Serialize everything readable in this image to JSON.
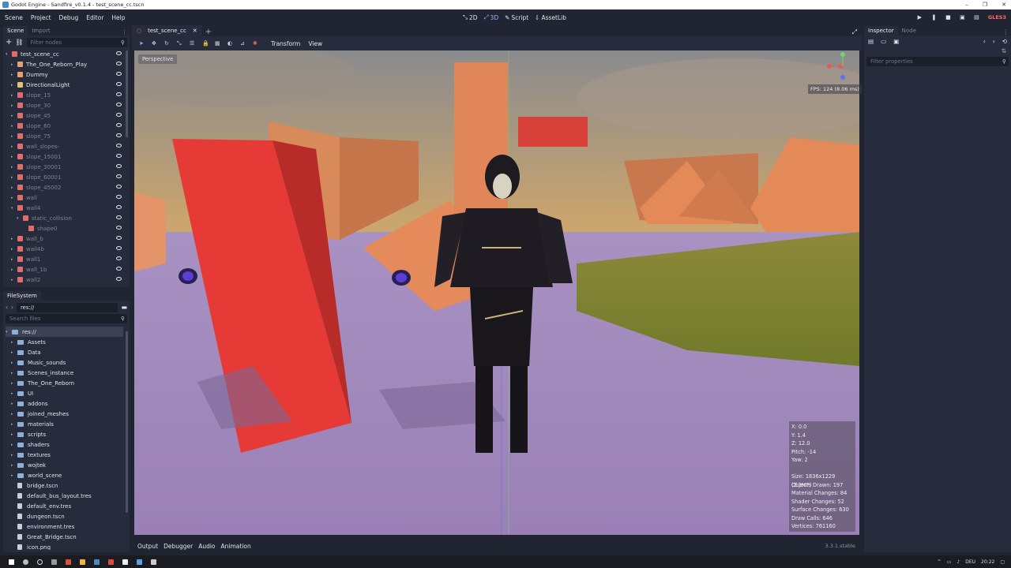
{
  "window": {
    "title": "Godot Engine - Sandfire_v0.1.4 - test_scene_cc.tscn",
    "controls": [
      "–",
      "❐",
      "✕"
    ]
  },
  "menu": [
    "Scene",
    "Project",
    "Debug",
    "Editor",
    "Help"
  ],
  "workspaces": [
    {
      "label": "2D",
      "active": false
    },
    {
      "label": "3D",
      "active": true
    },
    {
      "label": "Script",
      "active": false
    },
    {
      "label": "AssetLib",
      "active": false
    }
  ],
  "renderer": "GLES3",
  "scene_dock": {
    "tabs": [
      "Scene",
      "Import"
    ],
    "filter_placeholder": "Filter nodes",
    "nodes": [
      {
        "label": "test_scene_cc",
        "indent": 0,
        "color": "#e06c6c",
        "dim": false
      },
      {
        "label": "The_One_Reborn_Play",
        "indent": 1,
        "color": "#e8a070",
        "dim": false
      },
      {
        "label": "Dummy",
        "indent": 1,
        "color": "#e8a070",
        "dim": false
      },
      {
        "label": "DirectionalLight",
        "indent": 1,
        "color": "#e8c070",
        "dim": false
      },
      {
        "label": "slope_15",
        "indent": 1,
        "color": "#e06c6c",
        "dim": true
      },
      {
        "label": "slope_30",
        "indent": 1,
        "color": "#e06c6c",
        "dim": true
      },
      {
        "label": "slope_45",
        "indent": 1,
        "color": "#e06c6c",
        "dim": true
      },
      {
        "label": "slope_60",
        "indent": 1,
        "color": "#e06c6c",
        "dim": true
      },
      {
        "label": "slope_75",
        "indent": 1,
        "color": "#e06c6c",
        "dim": true
      },
      {
        "label": "wall_slopes-",
        "indent": 1,
        "color": "#e06c6c",
        "dim": true
      },
      {
        "label": "slope_15001",
        "indent": 1,
        "color": "#e06c6c",
        "dim": true
      },
      {
        "label": "slope_30001",
        "indent": 1,
        "color": "#e06c6c",
        "dim": true
      },
      {
        "label": "slope_60001",
        "indent": 1,
        "color": "#e06c6c",
        "dim": true
      },
      {
        "label": "slope_45002",
        "indent": 1,
        "color": "#e06c6c",
        "dim": true
      },
      {
        "label": "wall",
        "indent": 1,
        "color": "#e06c6c",
        "dim": true
      },
      {
        "label": "wall4",
        "indent": 1,
        "color": "#e06c6c",
        "dim": true
      },
      {
        "label": "static_collision",
        "indent": 2,
        "color": "#e06c6c",
        "dim": true
      },
      {
        "label": "shape0",
        "indent": 3,
        "color": "#e06c6c",
        "dim": true
      },
      {
        "label": "wall_b",
        "indent": 1,
        "color": "#e06c6c",
        "dim": true
      },
      {
        "label": "wall4b",
        "indent": 1,
        "color": "#e06c6c",
        "dim": true
      },
      {
        "label": "wall1",
        "indent": 1,
        "color": "#e06c6c",
        "dim": true
      },
      {
        "label": "wall_1b",
        "indent": 1,
        "color": "#e06c6c",
        "dim": true
      },
      {
        "label": "wall2",
        "indent": 1,
        "color": "#e06c6c",
        "dim": true
      }
    ]
  },
  "filesystem": {
    "tab": "FileSystem",
    "path": "res://",
    "search_placeholder": "Search files",
    "root": "res://",
    "entries": [
      {
        "label": "Assets",
        "type": "folder"
      },
      {
        "label": "Data",
        "type": "folder"
      },
      {
        "label": "Music_sounds",
        "type": "folder"
      },
      {
        "label": "Scenes_instance",
        "type": "folder"
      },
      {
        "label": "The_One_Reborn",
        "type": "folder"
      },
      {
        "label": "UI",
        "type": "folder"
      },
      {
        "label": "addons",
        "type": "folder"
      },
      {
        "label": "joined_meshes",
        "type": "folder"
      },
      {
        "label": "materials",
        "type": "folder"
      },
      {
        "label": "scripts",
        "type": "folder"
      },
      {
        "label": "shaders",
        "type": "folder"
      },
      {
        "label": "textures",
        "type": "folder"
      },
      {
        "label": "wojtek",
        "type": "folder"
      },
      {
        "label": "world_scene",
        "type": "folder"
      },
      {
        "label": "bridge.tscn",
        "type": "file"
      },
      {
        "label": "default_bus_layout.tres",
        "type": "file"
      },
      {
        "label": "default_env.tres",
        "type": "file"
      },
      {
        "label": "dungeon.tscn",
        "type": "file"
      },
      {
        "label": "environment.tres",
        "type": "file"
      },
      {
        "label": "Great_Bridge.tscn",
        "type": "file"
      },
      {
        "label": "icon.png",
        "type": "file"
      }
    ]
  },
  "viewport": {
    "tab": "test_scene_cc",
    "menus": [
      "Transform",
      "View"
    ],
    "perspective": "Perspective",
    "fps": "FPS: 124 (8.06 ms)",
    "stats": [
      "X: 0.0",
      "Y: 1.4",
      "Z: 12.0",
      "Pitch: -14",
      "Yaw: 2",
      "",
      "Size: 1836x1229 (2.3MP)",
      "Objects Drawn: 197",
      "Material Changes: 84",
      "Shader Changes: 52",
      "Surface Changes: 630",
      "Draw Calls: 646",
      "Vertices: 761160"
    ]
  },
  "bottom_panel": {
    "tabs": [
      "Output",
      "Debugger",
      "Audio",
      "Animation"
    ],
    "version": "3.3.1.stable"
  },
  "inspector": {
    "tabs": [
      "Inspector",
      "Node"
    ],
    "filter_placeholder": "Filter properties"
  },
  "taskbar": {
    "lang": "DEU",
    "time": "20:22"
  },
  "colors": {
    "accent": "#8fb4ff",
    "panel": "#262c3b",
    "bg": "#202531",
    "renderer": "#ff6b6b"
  }
}
